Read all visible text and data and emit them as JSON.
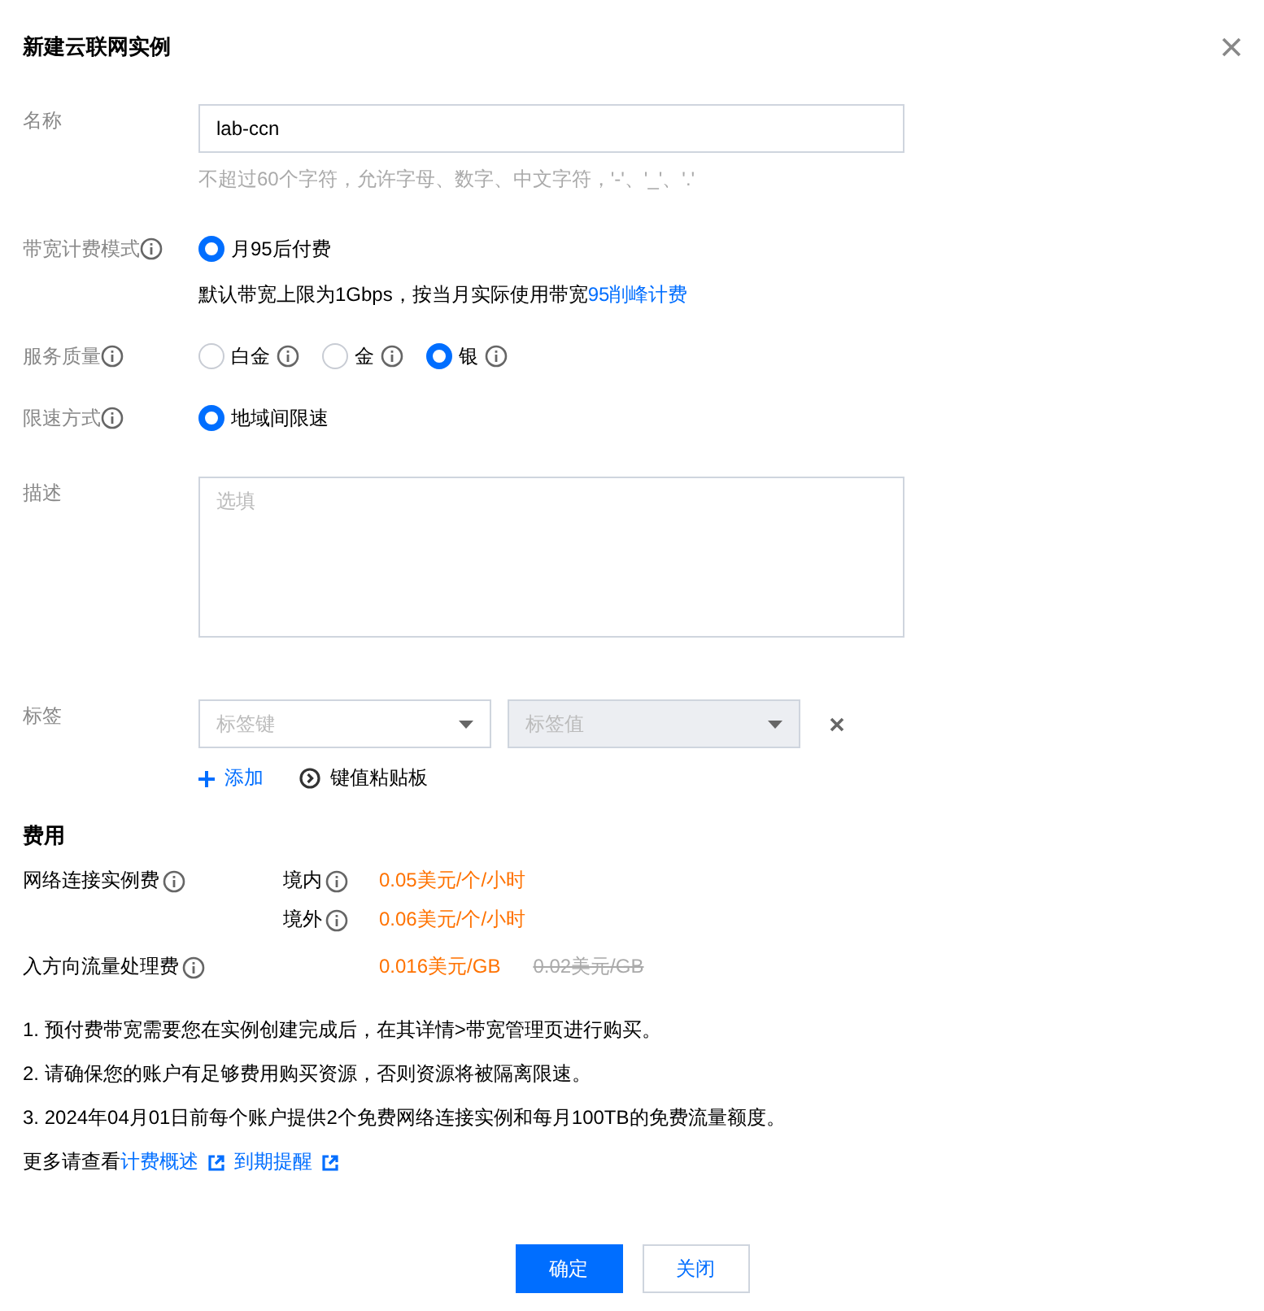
{
  "dialog": {
    "title": "新建云联网实例"
  },
  "name": {
    "label": "名称",
    "value": "lab-ccn",
    "hint": "不超过60个字符，允许字母、数字、中文字符，'-'、'_'、'.'"
  },
  "billing_mode": {
    "label": "带宽计费模式",
    "options_info": false,
    "options": [
      {
        "label": "月95后付费",
        "selected": true
      }
    ],
    "note": "默认带宽上限为1Gbps，按当月实际使用带宽",
    "note_link": "95削峰计费"
  },
  "service_quality": {
    "label": "服务质量",
    "options_info": true,
    "options": [
      {
        "label": "白金",
        "selected": false
      },
      {
        "label": "金",
        "selected": false
      },
      {
        "label": "银",
        "selected": true
      }
    ]
  },
  "rate_limit": {
    "label": "限速方式",
    "options_info": false,
    "options": [
      {
        "label": "地域间限速",
        "selected": true
      }
    ]
  },
  "description": {
    "label": "描述",
    "placeholder": "选填"
  },
  "tags": {
    "label": "标签",
    "key_placeholder": "标签键",
    "value_placeholder": "标签值",
    "value_disabled": true,
    "add": "添加",
    "paste": "键值粘贴板"
  },
  "fees": {
    "title": "费用",
    "rows": [
      {
        "label": "网络连接实例费",
        "items": [
          {
            "region": "境内",
            "price": "0.05美元/个/小时"
          },
          {
            "region": "境外",
            "price": "0.06美元/个/小时"
          }
        ]
      },
      {
        "label": "入方向流量处理费",
        "items": [
          {
            "price": "0.016美元/GB",
            "old_price": "0.02美元/GB"
          }
        ]
      }
    ]
  },
  "notes": [
    "1. 预付费带宽需要您在实例创建完成后，在其详情>带宽管理页进行购买。",
    "2. 请确保您的账户有足够费用购买资源，否则资源将被隔离限速。",
    "3. 2024年04月01日前每个账户提供2个免费网络连接实例和每月100TB的免费流量额度。"
  ],
  "more": {
    "prefix": "更多请查看",
    "links": [
      "计费概述",
      "到期提醒"
    ]
  },
  "buttons": [
    {
      "label": "确定",
      "kind": "primary"
    },
    {
      "label": "关闭",
      "kind": "default"
    }
  ]
}
